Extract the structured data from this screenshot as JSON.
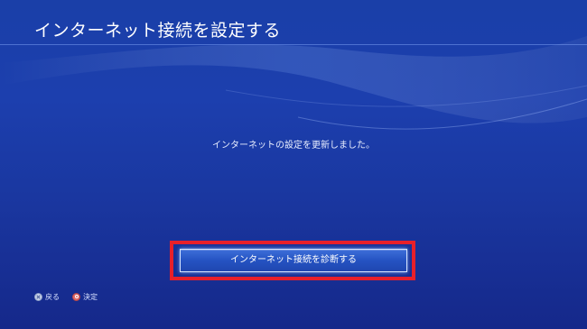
{
  "header": {
    "title": "インターネット接続を設定する"
  },
  "main": {
    "message": "インターネットの設定を更新しました。",
    "diagnose_button_label": "インターネット接続を診断する"
  },
  "footer": {
    "back_label": "戻る",
    "confirm_label": "決定",
    "back_icon": "cross-button-icon",
    "confirm_icon": "circle-button-icon"
  },
  "colors": {
    "background": "#1a3fa8",
    "highlight": "#e8202a",
    "button": "#2553c2"
  }
}
